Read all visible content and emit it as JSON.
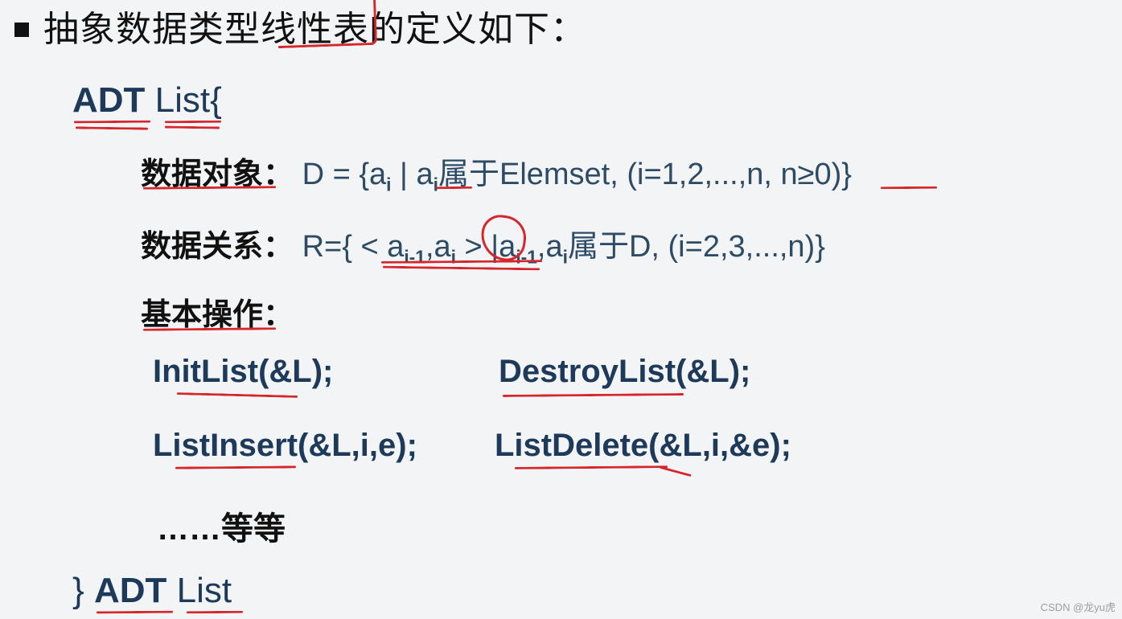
{
  "title": "抽象数据类型线性表的定义如下：",
  "adt": {
    "keyword": "ADT",
    "name": "List",
    "open_brace": "{",
    "close_brace": "}"
  },
  "sections": {
    "data_object": {
      "label": "数据对象：",
      "rest_before": " D = {a",
      "sub1": "i",
      "mid": " | a",
      "sub2": "i",
      "after": "属于Elemset, (i=1,2,...,n, n≥0)}"
    },
    "data_relation": {
      "label": "数据关系：",
      "text": " R={ < a",
      "sub1": "i-1",
      "mid1": ",a",
      "sub2": "i",
      "mid2": " > |a",
      "sub3": "i-1",
      "mid3": ",a",
      "sub4": "i",
      "after": "属于D, (i=2,3,...,n)}"
    },
    "basic_ops_label": "基本操作："
  },
  "ops": {
    "init": "InitList(&L);",
    "destroy": "DestroyList(&L);",
    "insert": "ListInsert(&L,i,e);",
    "delete": "ListDelete(&L,i,&e);",
    "etc": "……等等"
  },
  "watermark": "CSDN @龙yu虎"
}
